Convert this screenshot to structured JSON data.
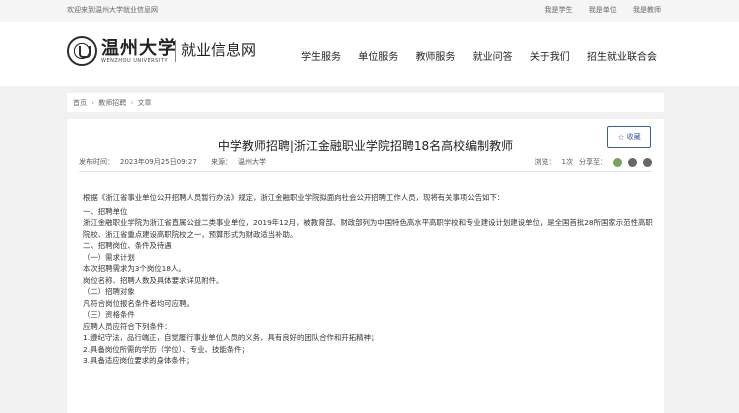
{
  "topbar": {
    "welcome": "欢迎来到温州大学就业信息网",
    "links": [
      "我是学生",
      "我是单位",
      "我是教师"
    ]
  },
  "header": {
    "school_name": "温州大学",
    "school_en": "WENZHOU UNIVERSITY",
    "site_name": "就业信息网",
    "nav": [
      "学生服务",
      "单位服务",
      "教师服务",
      "就业问答",
      "关于我们",
      "招生就业联合会"
    ]
  },
  "breadcrumb": {
    "home": "首页",
    "section": "教师招聘",
    "current": "文章",
    "separator": "›"
  },
  "article": {
    "title": "中学教师招聘|浙江金融职业学院招聘18名高校编制教师",
    "favorite_label": "收藏",
    "published_label": "发布时间：",
    "published_value": "2023年09月25日09:27",
    "source_label": "来源：",
    "source_value": "温州大学",
    "views_label": "浏览：",
    "views_value": "1次",
    "share_label": "分享至：",
    "paragraphs": [
      "根据《浙江省事业单位公开招聘人员暂行办法》规定，浙江金融职业学院拟面向社会公开招聘工作人员，现将有关事项公告如下：",
      "一、招聘单位",
      "浙江金融职业学院为浙江省直属公益二类事业单位，2019年12月，被教育部、财政部列为中国特色高水平高职学校和专业建设计划建设单位，是全国首批28所国家示范性高职院校、浙江省重点建设高职院校之一，预算形式为财政适当补助。",
      "二、招聘岗位、条件及待遇",
      "（一）需求计划",
      "本次招聘需求为3个岗位18人。",
      "岗位名称、招聘人数及具体要求详见附件。",
      "（二）招聘对象",
      "凡符合岗位报名条件者均可应聘。",
      "（三）资格条件",
      "应聘人员应符合下列条件：",
      "1.遵纪守法，品行端正，自觉履行事业单位人员的义务，具有良好的团队合作和开拓精神；",
      "2.具备岗位所需的学历（学位）、专业、技能条件；",
      "3.具备适应岗位要求的身体条件；"
    ]
  },
  "colors": {
    "accent": "#3a5da8",
    "page_bg": "#f1f1f1"
  },
  "icons": {
    "favorite": "star-icon",
    "share": [
      "wechat-icon",
      "weibo-icon",
      "qq-icon"
    ]
  }
}
